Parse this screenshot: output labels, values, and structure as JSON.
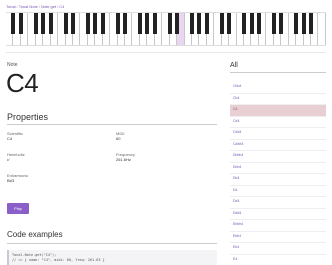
{
  "breadcrumb": [
    "Tonal",
    "Tonal.Note",
    "Note.get",
    "C4"
  ],
  "keyboard": {
    "white_key_count": 43,
    "active_white_key_index": 23
  },
  "note": {
    "label": "Note",
    "name": "C4"
  },
  "properties": {
    "title": "Properties",
    "items": [
      {
        "key": "Scientific",
        "value": "C4"
      },
      {
        "key": "MIDI",
        "value": "60"
      },
      {
        "key": "Helmholtz",
        "value": "c'"
      },
      {
        "key": "Frequency",
        "value": "261.6Hz"
      },
      {
        "key": "Enharmonic",
        "value": "B#3"
      }
    ],
    "play_label": "Play"
  },
  "code": {
    "title": "Code examples",
    "lines": [
      "Tonal.Note.get(\"C4\");",
      "// => { name: \"C4\", midi: 60, freq: 261.63 }"
    ]
  },
  "all": {
    "title": "All",
    "items": [
      "Cbb4",
      "Cb4",
      "C4",
      "C#4",
      "C##4",
      "C###4",
      "Dbbb4",
      "Dbb4",
      "Db4",
      "D4",
      "D#4",
      "D##4",
      "Ebbb4",
      "Ebb4",
      "Eb4",
      "E4"
    ],
    "selected_index": 2
  },
  "colors": {
    "accent": "#8b5fc8",
    "link": "#7b57b8",
    "selected_bg": "#e8cfd4"
  }
}
